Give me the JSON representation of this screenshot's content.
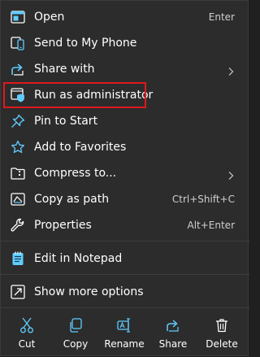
{
  "menu": {
    "items": [
      {
        "label": "Open",
        "shortcut": "Enter",
        "icon": "open-app-icon"
      },
      {
        "label": "Send to My Phone",
        "icon": "phone-icon"
      },
      {
        "label": "Share with",
        "icon": "share-icon",
        "submenu": true
      },
      {
        "label": "Run as administrator",
        "icon": "shield-admin-icon"
      },
      {
        "label": "Pin to Start",
        "icon": "pin-icon"
      },
      {
        "label": "Add to Favorites",
        "icon": "star-icon"
      },
      {
        "label": "Compress to...",
        "icon": "zip-folder-icon",
        "submenu": true
      },
      {
        "label": "Copy as path",
        "shortcut": "Ctrl+Shift+C",
        "icon": "copy-path-icon"
      },
      {
        "label": "Properties",
        "shortcut": "Alt+Enter",
        "icon": "wrench-icon"
      },
      {
        "label": "Edit in Notepad",
        "icon": "notepad-icon"
      },
      {
        "label": "Show more options",
        "icon": "more-options-icon"
      }
    ]
  },
  "actions": [
    {
      "label": "Cut",
      "icon": "scissors-icon"
    },
    {
      "label": "Copy",
      "icon": "copy-icon"
    },
    {
      "label": "Rename",
      "icon": "rename-icon"
    },
    {
      "label": "Share",
      "icon": "share-icon"
    },
    {
      "label": "Delete",
      "icon": "trash-icon"
    }
  ],
  "colors": {
    "background": "#2c2c2c",
    "accent": "#60cdff",
    "highlight_border": "#e0191d",
    "text": "#ffffff",
    "secondary_text": "#cfcfcf"
  }
}
